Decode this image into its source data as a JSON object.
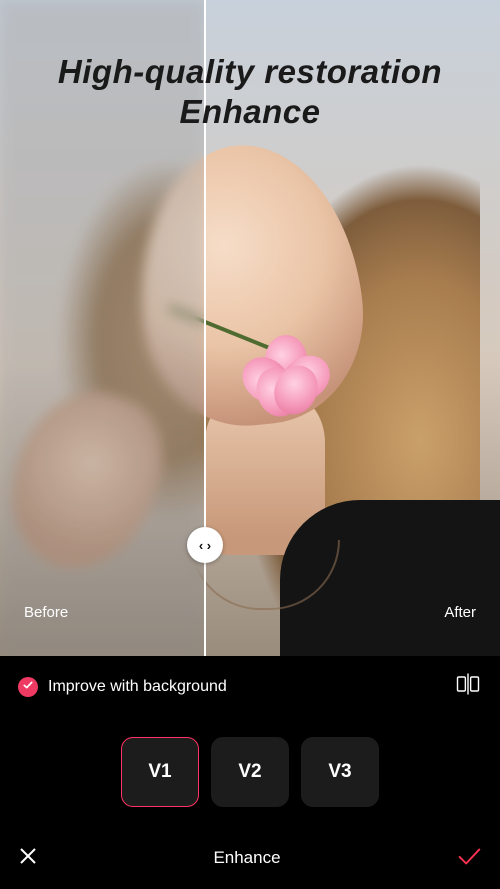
{
  "header": {
    "title_line1": "High-quality restoration",
    "title_line2": "Enhance"
  },
  "comparison": {
    "before_label": "Before",
    "after_label": "After",
    "slider_glyph": "‹ ›"
  },
  "options": {
    "improve_bg_label": "Improve with background",
    "improve_bg_checked": true
  },
  "versions": [
    {
      "label": "V1",
      "active": true
    },
    {
      "label": "V2",
      "active": false
    },
    {
      "label": "V3",
      "active": false
    }
  ],
  "footer": {
    "title": "Enhance"
  },
  "colors": {
    "accent": "#ff3464",
    "check_bg": "#ef3a63",
    "confirm": "#ff3252"
  }
}
